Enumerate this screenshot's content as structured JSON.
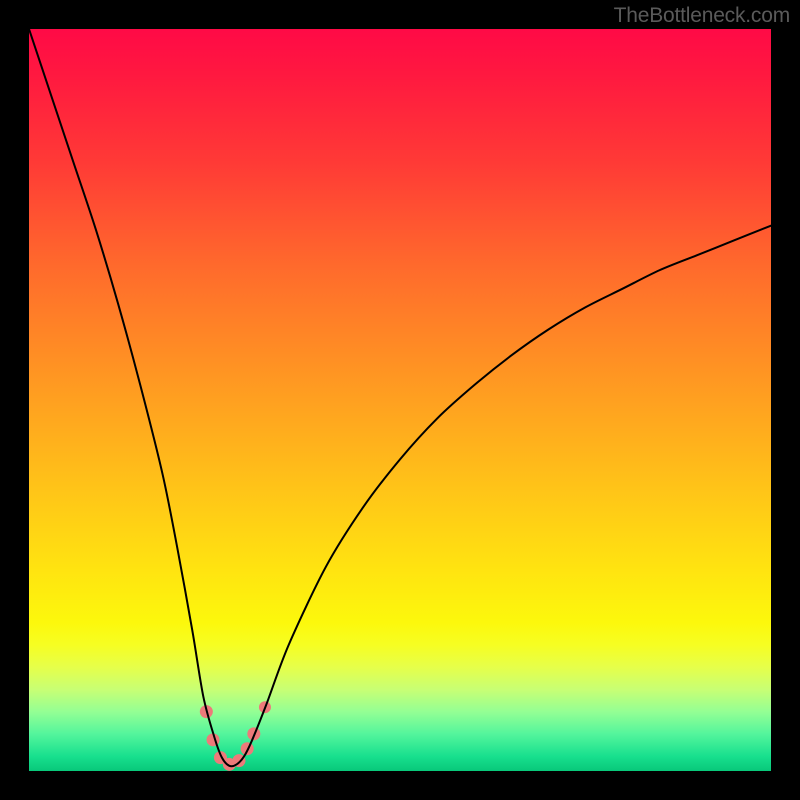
{
  "attribution": "TheBottleneck.com",
  "chart_data": {
    "type": "line",
    "title": "",
    "xlabel": "",
    "ylabel": "",
    "xlim": [
      0,
      100
    ],
    "ylim": [
      0,
      100
    ],
    "grid": false,
    "legend": false,
    "note": "Valley-shaped bottleneck curve over red-to-green gradient; minimum sits near x≈27, y≈0; left branch rises steeply to y=100 at x≈0, right branch asymptotes toward y≈75 at x=100.",
    "series": [
      {
        "name": "bottleneck-curve",
        "x": [
          0,
          3,
          6,
          9,
          12,
          15,
          18,
          20,
          22,
          23.5,
          25,
          26,
          27,
          28,
          29,
          30,
          32,
          35,
          40,
          45,
          50,
          55,
          60,
          65,
          70,
          75,
          80,
          85,
          90,
          95,
          100
        ],
        "values": [
          100,
          91,
          82,
          73,
          63,
          52,
          40,
          30,
          19,
          10,
          4.5,
          1.8,
          0.7,
          0.9,
          2,
          4,
          9,
          17,
          27.5,
          35.5,
          42,
          47.5,
          52,
          56,
          59.5,
          62.5,
          65,
          67.5,
          69.5,
          71.5,
          73.5
        ]
      }
    ],
    "markers": {
      "name": "valley-dots",
      "color": "#ed7a7a",
      "points": [
        {
          "x": 23.9,
          "y": 8.0,
          "r": 6.5
        },
        {
          "x": 24.8,
          "y": 4.2,
          "r": 6.5
        },
        {
          "x": 25.8,
          "y": 1.8,
          "r": 6.5
        },
        {
          "x": 27.0,
          "y": 0.9,
          "r": 6.5
        },
        {
          "x": 28.3,
          "y": 1.4,
          "r": 6.5
        },
        {
          "x": 29.4,
          "y": 3.0,
          "r": 6.5
        },
        {
          "x": 30.3,
          "y": 5.0,
          "r": 6.5
        },
        {
          "x": 31.8,
          "y": 8.6,
          "r": 6.0
        }
      ]
    }
  }
}
